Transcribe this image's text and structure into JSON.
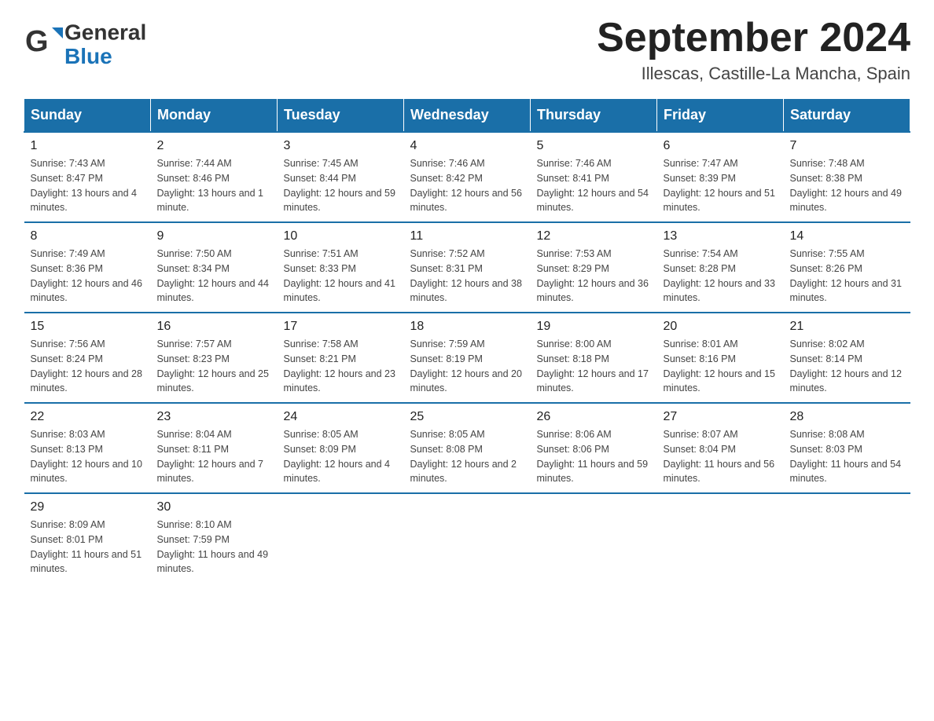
{
  "header": {
    "logo_line1": "General",
    "logo_line2": "Blue",
    "month_year": "September 2024",
    "location": "Illescas, Castille-La Mancha, Spain"
  },
  "days_of_week": [
    "Sunday",
    "Monday",
    "Tuesday",
    "Wednesday",
    "Thursday",
    "Friday",
    "Saturday"
  ],
  "weeks": [
    [
      {
        "day": "1",
        "sunrise": "7:43 AM",
        "sunset": "8:47 PM",
        "daylight": "13 hours and 4 minutes."
      },
      {
        "day": "2",
        "sunrise": "7:44 AM",
        "sunset": "8:46 PM",
        "daylight": "13 hours and 1 minute."
      },
      {
        "day": "3",
        "sunrise": "7:45 AM",
        "sunset": "8:44 PM",
        "daylight": "12 hours and 59 minutes."
      },
      {
        "day": "4",
        "sunrise": "7:46 AM",
        "sunset": "8:42 PM",
        "daylight": "12 hours and 56 minutes."
      },
      {
        "day": "5",
        "sunrise": "7:46 AM",
        "sunset": "8:41 PM",
        "daylight": "12 hours and 54 minutes."
      },
      {
        "day": "6",
        "sunrise": "7:47 AM",
        "sunset": "8:39 PM",
        "daylight": "12 hours and 51 minutes."
      },
      {
        "day": "7",
        "sunrise": "7:48 AM",
        "sunset": "8:38 PM",
        "daylight": "12 hours and 49 minutes."
      }
    ],
    [
      {
        "day": "8",
        "sunrise": "7:49 AM",
        "sunset": "8:36 PM",
        "daylight": "12 hours and 46 minutes."
      },
      {
        "day": "9",
        "sunrise": "7:50 AM",
        "sunset": "8:34 PM",
        "daylight": "12 hours and 44 minutes."
      },
      {
        "day": "10",
        "sunrise": "7:51 AM",
        "sunset": "8:33 PM",
        "daylight": "12 hours and 41 minutes."
      },
      {
        "day": "11",
        "sunrise": "7:52 AM",
        "sunset": "8:31 PM",
        "daylight": "12 hours and 38 minutes."
      },
      {
        "day": "12",
        "sunrise": "7:53 AM",
        "sunset": "8:29 PM",
        "daylight": "12 hours and 36 minutes."
      },
      {
        "day": "13",
        "sunrise": "7:54 AM",
        "sunset": "8:28 PM",
        "daylight": "12 hours and 33 minutes."
      },
      {
        "day": "14",
        "sunrise": "7:55 AM",
        "sunset": "8:26 PM",
        "daylight": "12 hours and 31 minutes."
      }
    ],
    [
      {
        "day": "15",
        "sunrise": "7:56 AM",
        "sunset": "8:24 PM",
        "daylight": "12 hours and 28 minutes."
      },
      {
        "day": "16",
        "sunrise": "7:57 AM",
        "sunset": "8:23 PM",
        "daylight": "12 hours and 25 minutes."
      },
      {
        "day": "17",
        "sunrise": "7:58 AM",
        "sunset": "8:21 PM",
        "daylight": "12 hours and 23 minutes."
      },
      {
        "day": "18",
        "sunrise": "7:59 AM",
        "sunset": "8:19 PM",
        "daylight": "12 hours and 20 minutes."
      },
      {
        "day": "19",
        "sunrise": "8:00 AM",
        "sunset": "8:18 PM",
        "daylight": "12 hours and 17 minutes."
      },
      {
        "day": "20",
        "sunrise": "8:01 AM",
        "sunset": "8:16 PM",
        "daylight": "12 hours and 15 minutes."
      },
      {
        "day": "21",
        "sunrise": "8:02 AM",
        "sunset": "8:14 PM",
        "daylight": "12 hours and 12 minutes."
      }
    ],
    [
      {
        "day": "22",
        "sunrise": "8:03 AM",
        "sunset": "8:13 PM",
        "daylight": "12 hours and 10 minutes."
      },
      {
        "day": "23",
        "sunrise": "8:04 AM",
        "sunset": "8:11 PM",
        "daylight": "12 hours and 7 minutes."
      },
      {
        "day": "24",
        "sunrise": "8:05 AM",
        "sunset": "8:09 PM",
        "daylight": "12 hours and 4 minutes."
      },
      {
        "day": "25",
        "sunrise": "8:05 AM",
        "sunset": "8:08 PM",
        "daylight": "12 hours and 2 minutes."
      },
      {
        "day": "26",
        "sunrise": "8:06 AM",
        "sunset": "8:06 PM",
        "daylight": "11 hours and 59 minutes."
      },
      {
        "day": "27",
        "sunrise": "8:07 AM",
        "sunset": "8:04 PM",
        "daylight": "11 hours and 56 minutes."
      },
      {
        "day": "28",
        "sunrise": "8:08 AM",
        "sunset": "8:03 PM",
        "daylight": "11 hours and 54 minutes."
      }
    ],
    [
      {
        "day": "29",
        "sunrise": "8:09 AM",
        "sunset": "8:01 PM",
        "daylight": "11 hours and 51 minutes."
      },
      {
        "day": "30",
        "sunrise": "8:10 AM",
        "sunset": "7:59 PM",
        "daylight": "11 hours and 49 minutes."
      },
      null,
      null,
      null,
      null,
      null
    ]
  ]
}
